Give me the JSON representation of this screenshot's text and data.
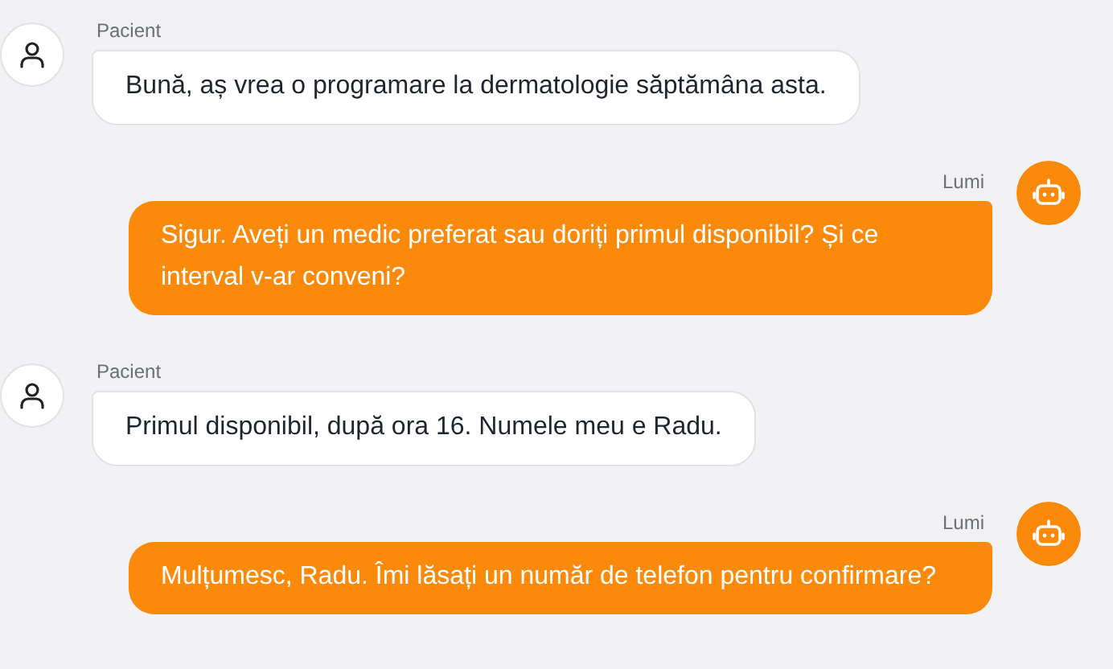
{
  "messages": [
    {
      "kind": "patient",
      "sender": "Pacient",
      "text": "Bună, aș vrea o programare la dermatologie săptămâna asta."
    },
    {
      "kind": "bot",
      "sender": "Lumi",
      "text": "Sigur. Aveți un medic preferat sau doriți primul disponibil? Și ce interval v-ar conveni?"
    },
    {
      "kind": "patient",
      "sender": "Pacient",
      "text": "Primul disponibil, după ora 16. Numele meu e Radu."
    },
    {
      "kind": "bot",
      "sender": "Lumi",
      "text": "Mulțumesc, Radu. Îmi lăsați un număr de telefon pentru confirmare?"
    }
  ]
}
